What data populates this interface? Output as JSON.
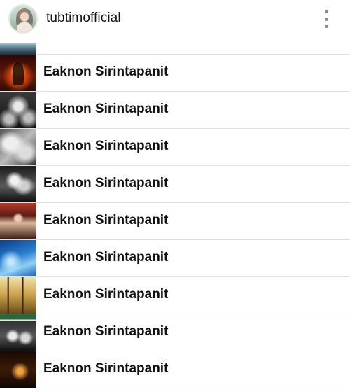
{
  "header": {
    "username": "tubtimofficial",
    "avatar_icon": "profile-avatar",
    "more_icon": "vertical-ellipsis-icon"
  },
  "list": {
    "items": [
      {
        "title": "Eaknon Sirintapanit"
      },
      {
        "title": "Eaknon Sirintapanit"
      },
      {
        "title": "Eaknon Sirintapanit"
      },
      {
        "title": "Eaknon Sirintapanit"
      },
      {
        "title": "Eaknon Sirintapanit"
      },
      {
        "title": "Eaknon Sirintapanit"
      },
      {
        "title": "Eaknon Sirintapanit"
      },
      {
        "title": "Eaknon Sirintapanit"
      },
      {
        "title": "Eaknon Sirintapanit"
      }
    ]
  },
  "colors": {
    "text": "#111111",
    "divider": "#e2e2e2",
    "icon_gray": "#8a8a8a",
    "background": "#ffffff"
  }
}
